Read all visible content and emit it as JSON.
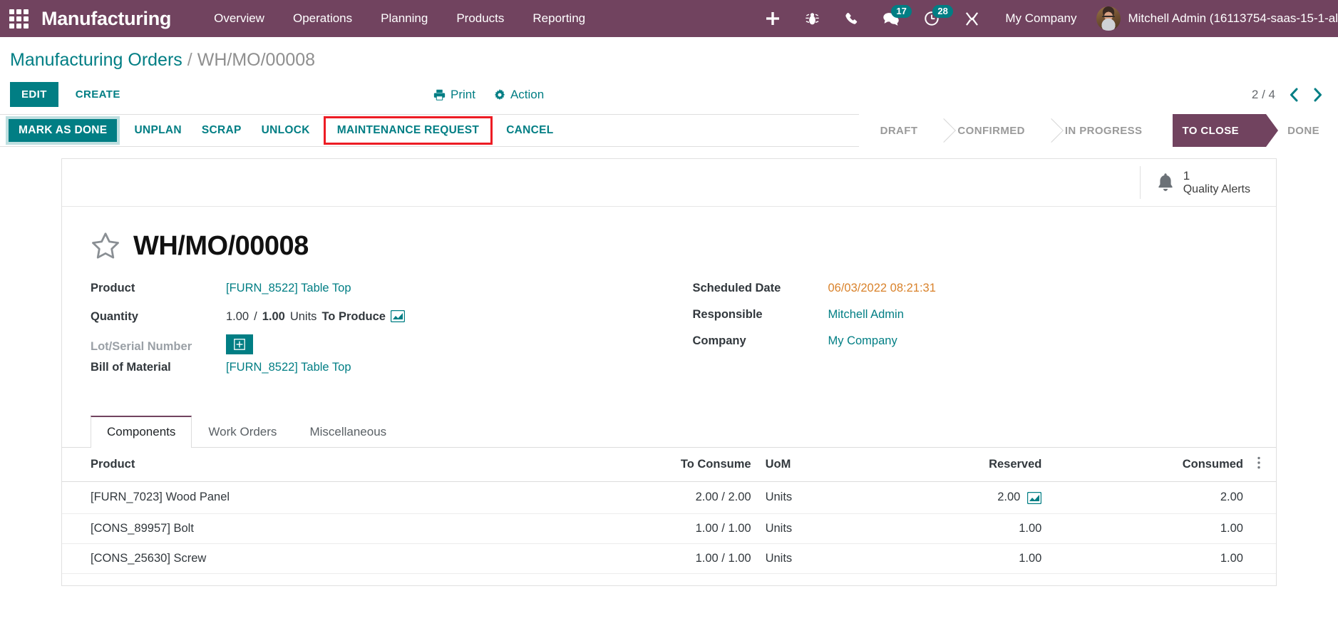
{
  "navbar": {
    "apps_icon": "apps-grid-icon",
    "brand": "Manufacturing",
    "menu": [
      {
        "label": "Overview"
      },
      {
        "label": "Operations"
      },
      {
        "label": "Planning"
      },
      {
        "label": "Products"
      },
      {
        "label": "Reporting"
      }
    ],
    "icons": [
      {
        "name": "plus-icon",
        "badge": null
      },
      {
        "name": "bug-icon",
        "badge": null
      },
      {
        "name": "phone-icon",
        "badge": null
      },
      {
        "name": "chat-icon",
        "badge": "17"
      },
      {
        "name": "activity-clock-icon",
        "badge": "28"
      },
      {
        "name": "tools-icon",
        "badge": null
      }
    ],
    "company": "My Company",
    "user_name": "Mitchell Admin (16113754-saas-15-1-al",
    "bg_color": "#71435f"
  },
  "breadcrumb": {
    "root": "Manufacturing Orders",
    "separator": "/",
    "current": "WH/MO/00008"
  },
  "control_panel": {
    "edit_label": "EDIT",
    "create_label": "CREATE",
    "print_label": "Print",
    "action_label": "Action",
    "pager_count": "2 / 4",
    "prev_icon": "chevron-left-icon",
    "next_icon": "chevron-right-icon"
  },
  "statusbar": {
    "buttons": [
      {
        "label": "MARK AS DONE",
        "style": "primary"
      },
      {
        "label": "UNPLAN",
        "style": "link"
      },
      {
        "label": "SCRAP",
        "style": "link"
      },
      {
        "label": "UNLOCK",
        "style": "link"
      },
      {
        "label": "MAINTENANCE REQUEST",
        "style": "highlighted"
      },
      {
        "label": "CANCEL",
        "style": "link"
      }
    ],
    "highlight_color": "#ed1c24",
    "stages": [
      {
        "label": "DRAFT",
        "active": false
      },
      {
        "label": "CONFIRMED",
        "active": false
      },
      {
        "label": "IN PROGRESS",
        "active": false
      },
      {
        "label": "TO CLOSE",
        "active": true
      },
      {
        "label": "DONE",
        "active": false
      }
    ],
    "active_color": "#71435f"
  },
  "sheet": {
    "stat_buttons": [
      {
        "icon": "bell-icon",
        "count": "1",
        "label": "Quality Alerts"
      }
    ],
    "star_icon": "star-outline-icon",
    "title": "WH/MO/00008",
    "fields_left": [
      {
        "label": "Product",
        "value": "[FURN_8522] Table Top",
        "kind": "link"
      },
      {
        "label": "Quantity",
        "qty_done": "1.00",
        "slash": "/",
        "qty_total": "1.00",
        "uom": "Units",
        "suffix": "To Produce",
        "chart_icon": "bar-chart-icon",
        "kind": "quantity"
      },
      {
        "label": "Lot/Serial Number",
        "button_icon": "add-box-icon",
        "kind": "lot",
        "muted": true
      },
      {
        "label": "Bill of Material",
        "value": "[FURN_8522] Table Top",
        "kind": "link"
      }
    ],
    "fields_right": [
      {
        "label": "Scheduled Date",
        "value": "06/03/2022 08:21:31",
        "kind": "orange"
      },
      {
        "label": "Responsible",
        "value": "Mitchell Admin",
        "kind": "link"
      },
      {
        "label": "Company",
        "value": "My Company",
        "kind": "link"
      }
    ],
    "tabs": [
      {
        "label": "Components",
        "active": true
      },
      {
        "label": "Work Orders",
        "active": false
      },
      {
        "label": "Miscellaneous",
        "active": false
      }
    ],
    "table": {
      "columns": [
        {
          "label": "Product",
          "align": "left"
        },
        {
          "label": "To Consume",
          "align": "right"
        },
        {
          "label": "UoM",
          "align": "left"
        },
        {
          "label": "Reserved",
          "align": "right"
        },
        {
          "label": "Consumed",
          "align": "right"
        }
      ],
      "options_icon": "column-options-icon",
      "rows": [
        {
          "product": "[FURN_7023] Wood Panel",
          "to_consume": "2.00 / 2.00",
          "uom": "Units",
          "reserved": "2.00",
          "reserved_icon": "bar-chart-icon",
          "consumed": "2.00"
        },
        {
          "product": "[CONS_89957] Bolt",
          "to_consume": "1.00 / 1.00",
          "uom": "Units",
          "reserved": "1.00",
          "reserved_icon": null,
          "consumed": "1.00"
        },
        {
          "product": "[CONS_25630] Screw",
          "to_consume": "1.00 / 1.00",
          "uom": "Units",
          "reserved": "1.00",
          "reserved_icon": null,
          "consumed": "1.00"
        }
      ]
    }
  },
  "colors": {
    "accent_teal": "#017e84",
    "brand_purple": "#71435f",
    "orange": "#d9822b",
    "green": "#0f9e3e",
    "red_highlight": "#ed1c24"
  }
}
